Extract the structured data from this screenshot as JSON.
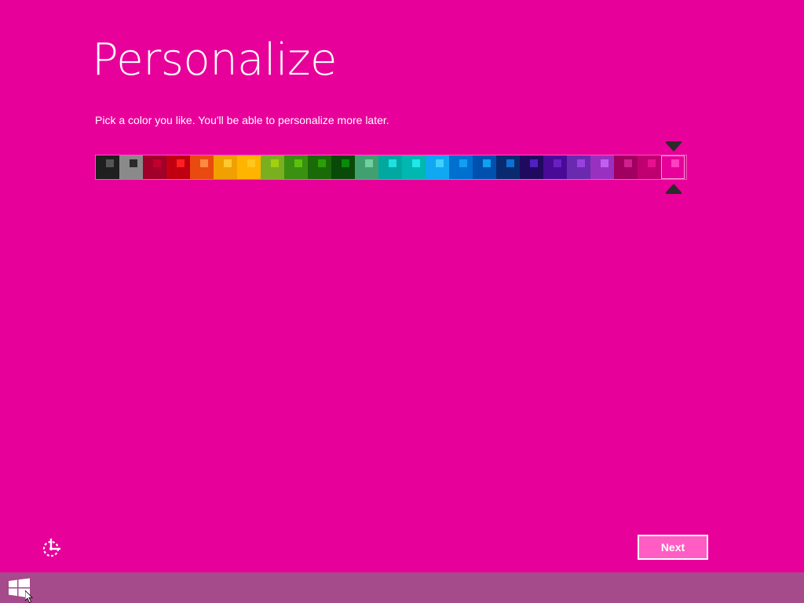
{
  "page": {
    "title": "Personalize",
    "subtitle": "Pick a color you like. You'll be able to personalize more later."
  },
  "color_picker": {
    "selected_index": 24,
    "swatches": [
      {
        "bg": "#1f1f1f",
        "accent": "#555555"
      },
      {
        "bg": "#8a8a8a",
        "accent": "#2a2a2a"
      },
      {
        "bg": "#a0002a",
        "accent": "#c2002e"
      },
      {
        "bg": "#c00010",
        "accent": "#ff2020"
      },
      {
        "bg": "#e84a10",
        "accent": "#ff8a40"
      },
      {
        "bg": "#f0a000",
        "accent": "#ffc830"
      },
      {
        "bg": "#ffb400",
        "accent": "#ffc820"
      },
      {
        "bg": "#7ab020",
        "accent": "#a0d010"
      },
      {
        "bg": "#3a9010",
        "accent": "#5cc010"
      },
      {
        "bg": "#1a6a08",
        "accent": "#2aa008"
      },
      {
        "bg": "#0a4a08",
        "accent": "#0a8a0a"
      },
      {
        "bg": "#40a070",
        "accent": "#70d0a0"
      },
      {
        "bg": "#00a8a0",
        "accent": "#20e0e0"
      },
      {
        "bg": "#00b8b0",
        "accent": "#20e8e8"
      },
      {
        "bg": "#10a8f0",
        "accent": "#40d0ff"
      },
      {
        "bg": "#0070d0",
        "accent": "#10a0f0"
      },
      {
        "bg": "#0050b0",
        "accent": "#10a0f0"
      },
      {
        "bg": "#0a2a70",
        "accent": "#1070d0"
      },
      {
        "bg": "#200a60",
        "accent": "#5020c0"
      },
      {
        "bg": "#4a0a98",
        "accent": "#6a20c0"
      },
      {
        "bg": "#6a2ab0",
        "accent": "#9a40e0"
      },
      {
        "bg": "#9a30c0",
        "accent": "#c060f0"
      },
      {
        "bg": "#a00060",
        "accent": "#d02090"
      },
      {
        "bg": "#c00070",
        "accent": "#e81090"
      },
      {
        "bg": "#e8009a",
        "accent": "#ff40c0"
      }
    ]
  },
  "footer": {
    "ease_of_access_icon": "ease-of-access-icon",
    "next_label": "Next"
  },
  "taskbar": {
    "start_icon": "windows-logo-icon",
    "color": "#a54a8a"
  },
  "colors": {
    "background": "#e8009a",
    "button_fill": "#ff5cc4"
  }
}
